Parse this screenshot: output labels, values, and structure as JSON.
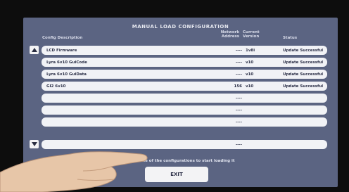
{
  "screen": {
    "title": "MANUAL LOAD CONFIGURATION",
    "columns": {
      "description": "Config Description",
      "network_address_line1": "Network",
      "network_address_line2": "Address",
      "current_version_line1": "Current",
      "current_version_line2": "Version",
      "status": "Status"
    },
    "rows": [
      {
        "description": "LCD Firmware",
        "address": "----",
        "version": "1v8i",
        "status": "Update Successful"
      },
      {
        "description": "Lyra 6v10 GuiCode",
        "address": "----",
        "version": "v10",
        "status": "Update Successful"
      },
      {
        "description": "Lyra 6v10 GuiData",
        "address": "----",
        "version": "v10",
        "status": "Update Successful"
      },
      {
        "description": "GI2 6v10",
        "address": "156",
        "version": "v10",
        "status": "Update Successful"
      },
      {
        "description": "",
        "address": "----",
        "version": "",
        "status": ""
      },
      {
        "description": "",
        "address": "----",
        "version": "",
        "status": ""
      },
      {
        "description": "",
        "address": "----",
        "version": "",
        "status": ""
      },
      {
        "description": "",
        "address": "----",
        "version": "",
        "status": ""
      }
    ],
    "prompt": "Press one of the configurations to start loading it",
    "exit_label": "EXIT"
  },
  "colors": {
    "screen_bg": "#5b6482",
    "row_bg": "#f1f2f6",
    "row_text": "#2b2f47"
  },
  "icons": {
    "scroll_up": "triangle-up-icon",
    "scroll_down": "triangle-down-icon"
  }
}
